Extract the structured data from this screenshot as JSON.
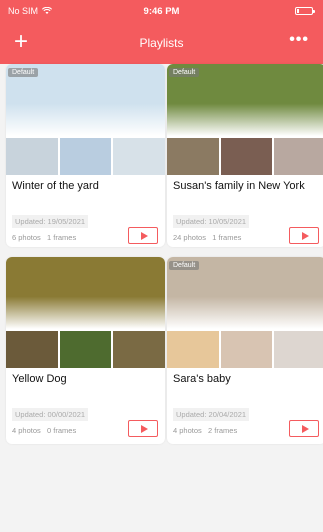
{
  "status": {
    "carrier": "No SIM",
    "time": "9:46 PM",
    "battery_level": 0.15
  },
  "header": {
    "add_icon": "plus-icon",
    "title": "Playlists",
    "more_icon": "more-icon"
  },
  "playlists": [
    {
      "badge": "Default",
      "name": "Winter of the yard",
      "updated": "Updated: 19/05/2021",
      "photos": "6 photos",
      "frames": "1 frames",
      "main_color": "#cfe1ee",
      "thumb_colors": [
        "#c8d3dc",
        "#b9cde0",
        "#d7e1e8"
      ]
    },
    {
      "badge": "Default",
      "name": "Susan's family in New York",
      "updated": "Updated: 10/05/2021",
      "photos": "24 photos",
      "frames": "1 frames",
      "main_color": "#6f8a3f",
      "thumb_colors": [
        "#8b7a62",
        "#7a5e52",
        "#b8a8a0"
      ]
    },
    {
      "badge": "",
      "name": "Yellow Dog",
      "updated": "Updated: 00/00/2021",
      "photos": "4 photos",
      "frames": "0 frames",
      "main_color": "#8a7a34",
      "thumb_colors": [
        "#6b5a3a",
        "#4e6b2f",
        "#7a6a44"
      ]
    },
    {
      "badge": "Default",
      "name": "Sara's baby",
      "updated": "Updated: 20/04/2021",
      "photos": "4 photos",
      "frames": "2 frames",
      "main_color": "#c4b6a4",
      "thumb_colors": [
        "#e7c79a",
        "#d8c4b2",
        "#ddd6d0"
      ]
    }
  ]
}
